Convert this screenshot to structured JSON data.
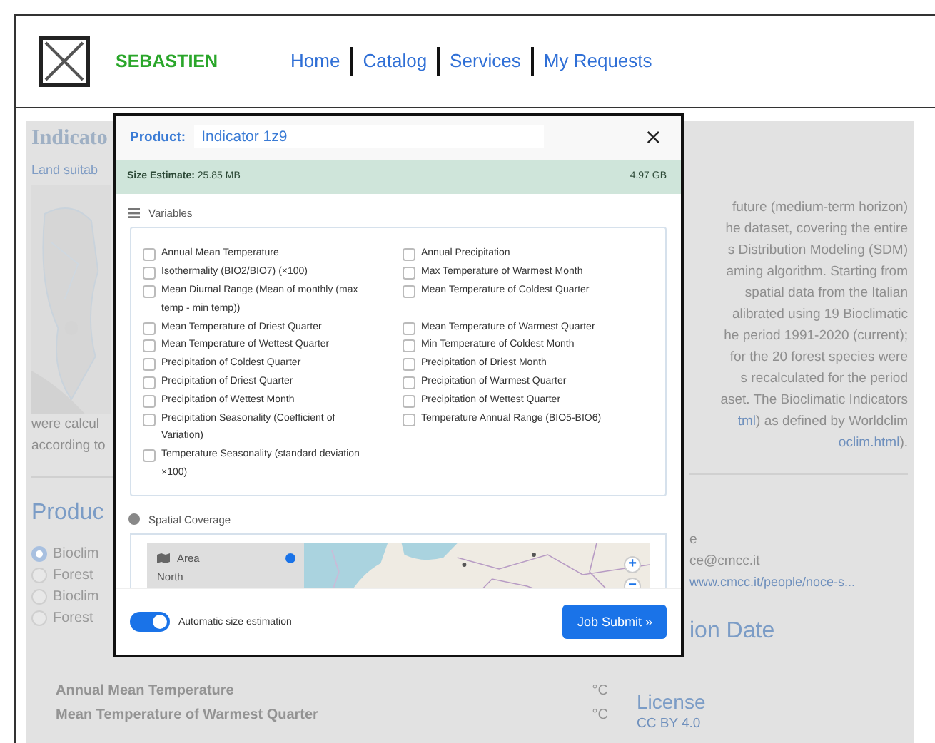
{
  "header": {
    "brand": "SEBASTIEN",
    "nav": [
      "Home",
      "Catalog",
      "Services",
      "My Requests"
    ]
  },
  "background": {
    "title": "Indicato",
    "subtitle": "Land suitab",
    "description_right": [
      [
        {
          "text": "future (medium-term horizon)",
          "link": false
        }
      ],
      [
        {
          "text": "he dataset, covering the entire",
          "link": false
        }
      ],
      [
        {
          "text": "s Distribution Modeling (SDM)",
          "link": false
        }
      ],
      [
        {
          "text": "aming algorithm. Starting from",
          "link": false
        }
      ],
      [
        {
          "text": "spatial data from the Italian",
          "link": false
        }
      ],
      [
        {
          "text": "alibrated using 19 Bioclimatic",
          "link": false
        }
      ],
      [
        {
          "text": "he period 1991-2020 (current);",
          "link": false
        }
      ],
      [
        {
          "text": "for the 20 forest species were",
          "link": false
        }
      ],
      [
        {
          "text": "s recalculated for the period",
          "link": false
        }
      ],
      [
        {
          "text": "aset. The Bioclimatic Indicators",
          "link": false
        }
      ],
      [
        {
          "text": "tml",
          "link": true
        },
        {
          "text": ") as defined by Worldclim",
          "link": false
        }
      ],
      [
        {
          "text": "oclim.html",
          "link": true
        },
        {
          "text": ").",
          "link": false
        }
      ]
    ],
    "description_left": [
      "were calcul",
      "according to"
    ],
    "products_heading": "Produc",
    "product_options": [
      {
        "label": "Bioclim",
        "selected": true
      },
      {
        "label": "Forest",
        "selected": false
      },
      {
        "label": "Bioclim",
        "selected": false
      },
      {
        "label": "Forest",
        "selected": false
      }
    ],
    "contact_lines": [
      {
        "text": "e",
        "kind": "text"
      },
      {
        "text": "ce@cmcc.it",
        "kind": "text"
      },
      {
        "text": "www.cmcc.it/people/noce-s...",
        "kind": "link"
      }
    ],
    "date_heading": "ion Date",
    "variable_units": [
      {
        "name": "Annual Mean Temperature",
        "unit": "°C"
      },
      {
        "name": "Mean Temperature of Warmest Quarter",
        "unit": "°C"
      }
    ],
    "license_heading": "License",
    "license": "CC BY 4.0"
  },
  "modal": {
    "product_label": "Product:",
    "product_value": "Indicator 1z9",
    "close": "×",
    "size_label": "Size Estimate:",
    "size_value": "25.85 MB",
    "size_total": "4.97 GB",
    "variables_title": "Variables",
    "variables": [
      {
        "label": "Annual Mean Temperature",
        "checked": false
      },
      {
        "label": "Annual Precipitation",
        "checked": false
      },
      {
        "label": "Isothermality (BIO2/BIO7) (×100)",
        "checked": false
      },
      {
        "label": "Max Temperature of Warmest Month",
        "checked": false
      },
      {
        "label": "Mean Diurnal Range (Mean of monthly (max temp - min temp))",
        "checked": false
      },
      {
        "label": "Mean Temperature of Coldest Quarter",
        "checked": false
      },
      {
        "label": "Mean Temperature of Driest Quarter",
        "checked": false
      },
      {
        "label": "Mean Temperature of Warmest Quarter",
        "checked": false
      },
      {
        "label": "Mean Temperature of Wettest Quarter",
        "checked": false
      },
      {
        "label": "Min Temperature of Coldest Month",
        "checked": false
      },
      {
        "label": "Precipitation of Coldest Quarter",
        "checked": false
      },
      {
        "label": "Precipitation of Driest Month",
        "checked": false
      },
      {
        "label": "Precipitation of Driest Quarter",
        "checked": false
      },
      {
        "label": "Precipitation of Warmest Quarter",
        "checked": false
      },
      {
        "label": "Precipitation of Wettest Month",
        "checked": false
      },
      {
        "label": "Precipitation of Wettest Quarter",
        "checked": false
      },
      {
        "label": "Precipitation Seasonality (Coefficient of Variation)",
        "checked": false
      },
      {
        "label": "Temperature Annual Range (BIO5-BIO6)",
        "checked": false
      },
      {
        "label": "Temperature Seasonality (standard deviation ×100)",
        "checked": false
      }
    ],
    "spatial_title": "Spatial Coverage",
    "area": {
      "label": "Area",
      "selected": true,
      "value": "North"
    },
    "zoom_in": "+",
    "zoom_out": "−",
    "auto_estimate": {
      "label": "Automatic size estimation",
      "on": true
    },
    "submit": "Job Submit »"
  }
}
